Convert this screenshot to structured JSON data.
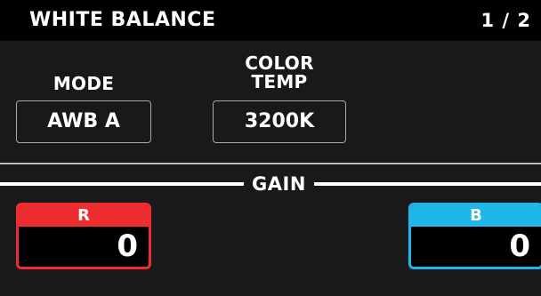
{
  "header": {
    "title": "WHITE BALANCE",
    "page": "1 / 2"
  },
  "mode": {
    "label": "MODE",
    "value": "AWB A"
  },
  "color_temp": {
    "label_line1": "COLOR",
    "label_line2": "TEMP",
    "value": "3200K"
  },
  "gain": {
    "title": "GAIN",
    "r": {
      "label": "R",
      "value": "0"
    },
    "b": {
      "label": "B",
      "value": "0"
    }
  },
  "colors": {
    "background": "#19191b",
    "header": "#000000",
    "red": "#ee2d31",
    "blue": "#21b6ea"
  }
}
